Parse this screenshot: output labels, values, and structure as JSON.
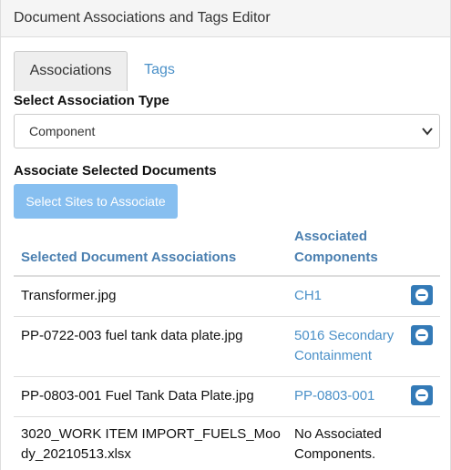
{
  "header": {
    "title": "Document Associations and Tags Editor"
  },
  "tabs": [
    {
      "label": "Associations",
      "active": true
    },
    {
      "label": "Tags",
      "active": false
    }
  ],
  "association_type": {
    "label": "Select Association Type",
    "selected": "Component"
  },
  "associate": {
    "label": "Associate Selected Documents",
    "button_label": "Select Sites to Associate"
  },
  "table": {
    "headers": {
      "documents": "Selected Document Associations",
      "components": "Associated Components"
    },
    "rows": [
      {
        "document": "Transformer.jpg",
        "component": "CH1",
        "removable": true
      },
      {
        "document": "PP-0722-003 fuel tank data plate.jpg",
        "component": "5016 Secondary Containment",
        "removable": true
      },
      {
        "document": "PP-0803-001 Fuel Tank Data Plate.jpg",
        "component": "PP-0803-001",
        "removable": true
      },
      {
        "document": "3020_WORK ITEM IMPORT_FUELS_Moody_20210513.xlsx",
        "component": "No Associated Components.",
        "removable": false
      }
    ]
  },
  "colors": {
    "link": "#4a90c8",
    "button_disabled": "#87bff0",
    "remove_button": "#337ab7",
    "header_text": "#4a7fb0"
  }
}
